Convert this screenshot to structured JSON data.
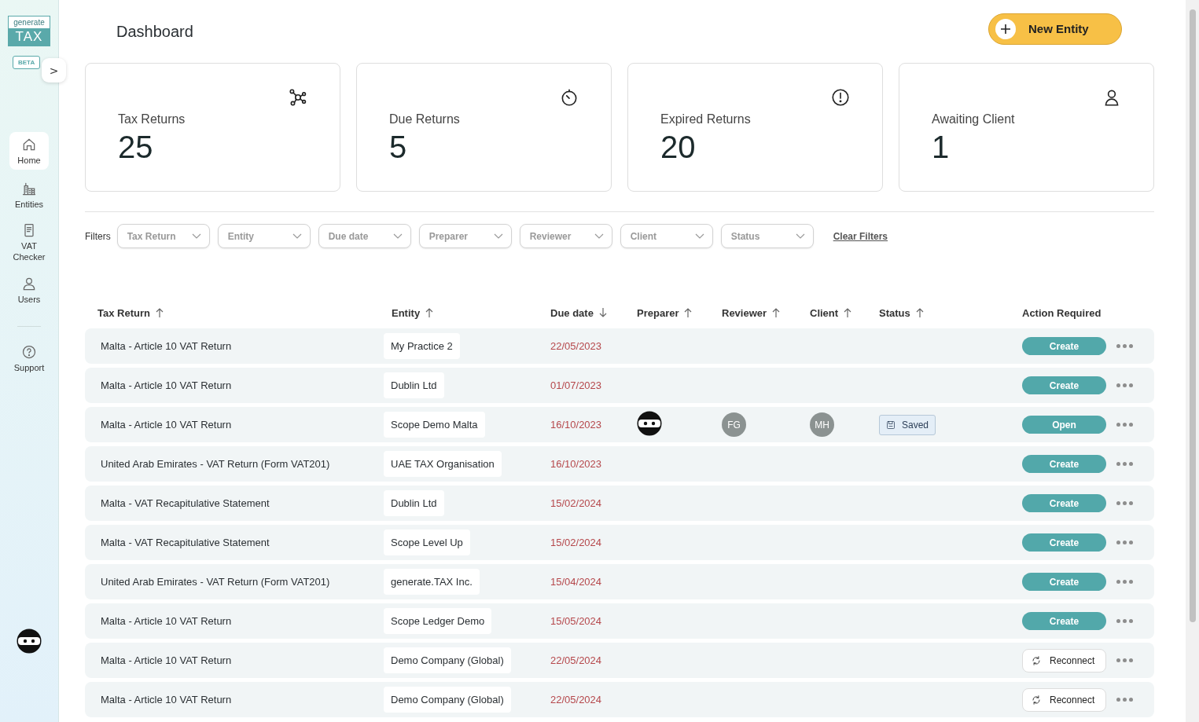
{
  "sidebar": {
    "logo_top": "generate",
    "logo_bottom": "TAX",
    "badge": "BETA",
    "toggle": ">",
    "items": [
      {
        "label": "Home",
        "selected": true
      },
      {
        "label": "Entities",
        "selected": false
      },
      {
        "label": "VAT Checker",
        "selected": false
      },
      {
        "label": "Users",
        "selected": false
      }
    ],
    "support": {
      "label": "Support",
      "selected": false
    }
  },
  "header": {
    "title": "Dashboard",
    "new_button": "New Entity"
  },
  "stats": [
    {
      "label": "Tax Returns",
      "value": "25"
    },
    {
      "label": "Due Returns",
      "value": "5"
    },
    {
      "label": "Expired Returns",
      "value": "20"
    },
    {
      "label": "Awaiting Client",
      "value": "1"
    }
  ],
  "filters": {
    "label": "Filters",
    "dropdowns": [
      "Tax Return",
      "Entity",
      "Due date",
      "Preparer",
      "Reviewer",
      "Client",
      "Status"
    ],
    "clear": "Clear Filters"
  },
  "table": {
    "columns": [
      {
        "label": "Tax Return",
        "sorted": true,
        "descending": false
      },
      {
        "label": "Entity",
        "sorted": true,
        "descending": false
      },
      {
        "label": "Due date",
        "sorted": true,
        "descending": true
      },
      {
        "label": "Preparer",
        "sorted": true,
        "descending": false
      },
      {
        "label": "Reviewer",
        "sorted": true,
        "descending": false
      },
      {
        "label": "Client",
        "sorted": true,
        "descending": false
      },
      {
        "label": "Status",
        "sorted": true,
        "descending": false
      },
      {
        "label": "Action Required",
        "sorted": false
      }
    ],
    "rows": [
      {
        "tax_return": "Malta - Article 10 VAT Return",
        "entity": "My Practice 2",
        "due_date": "22/05/2023",
        "action": {
          "kind": "primary",
          "label": "Create"
        }
      },
      {
        "tax_return": "Malta - Article 10 VAT Return",
        "entity": "Dublin Ltd",
        "due_date": "01/07/2023",
        "action": {
          "kind": "primary",
          "label": "Create"
        }
      },
      {
        "tax_return": "Malta - Article 10 VAT Return",
        "entity": "Scope Demo Malta",
        "due_date": "16/10/2023",
        "preparer_avatar": true,
        "reviewer": "FG",
        "client": "MH",
        "status": "Saved",
        "action": {
          "kind": "primary",
          "label": "Open"
        }
      },
      {
        "tax_return": "United Arab Emirates - VAT Return (Form VAT201)",
        "entity": "UAE TAX Organisation",
        "due_date": "16/10/2023",
        "action": {
          "kind": "primary",
          "label": "Create"
        }
      },
      {
        "tax_return": "Malta - VAT Recapitulative Statement",
        "entity": "Dublin Ltd",
        "due_date": "15/02/2024",
        "action": {
          "kind": "primary",
          "label": "Create"
        }
      },
      {
        "tax_return": "Malta - VAT Recapitulative Statement",
        "entity": "Scope Level Up",
        "due_date": "15/02/2024",
        "action": {
          "kind": "primary",
          "label": "Create"
        }
      },
      {
        "tax_return": "United Arab Emirates - VAT Return (Form VAT201)",
        "entity": "generate.TAX Inc.",
        "due_date": "15/04/2024",
        "action": {
          "kind": "primary",
          "label": "Create"
        }
      },
      {
        "tax_return": "Malta - Article 10 VAT Return",
        "entity": "Scope Ledger Demo",
        "due_date": "15/05/2024",
        "action": {
          "kind": "primary",
          "label": "Create"
        }
      },
      {
        "tax_return": "Malta - Article 10 VAT Return",
        "entity": "Demo Company (Global)",
        "due_date": "22/05/2024",
        "action": {
          "kind": "reconnect",
          "label": "Reconnect"
        }
      },
      {
        "tax_return": "Malta - Article 10 VAT Return",
        "entity": "Demo Company (Global)",
        "due_date": "22/05/2024",
        "action": {
          "kind": "reconnect",
          "label": "Reconnect"
        }
      }
    ]
  }
}
